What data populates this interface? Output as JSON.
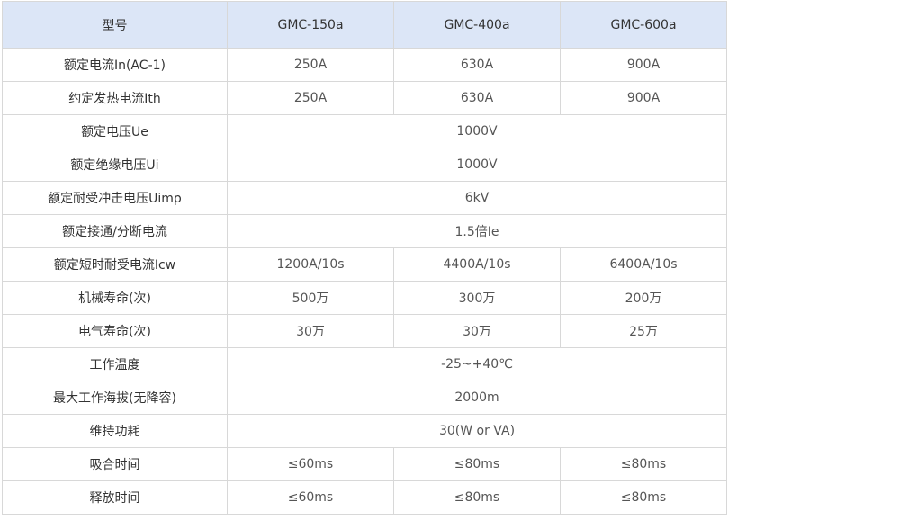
{
  "table": {
    "headers": [
      "型号",
      "GMC-150a",
      "GMC-400a",
      "GMC-600a"
    ],
    "rows": [
      {
        "label": "额定电流In(AC-1)",
        "values": [
          "250A",
          "630A",
          "900A"
        ]
      },
      {
        "label": "约定发热电流Ith",
        "values": [
          "250A",
          "630A",
          "900A"
        ]
      },
      {
        "label": "额定电压Ue",
        "values": [
          "1000V"
        ]
      },
      {
        "label": "额定绝缘电压Ui",
        "values": [
          "1000V"
        ]
      },
      {
        "label": "额定耐受冲击电压Uimp",
        "values": [
          "6kV"
        ]
      },
      {
        "label": "额定接通/分断电流",
        "values": [
          "1.5倍Ie"
        ]
      },
      {
        "label": "额定短时耐受电流Icw",
        "values": [
          "1200A/10s",
          "4400A/10s",
          "6400A/10s"
        ]
      },
      {
        "label": "机械寿命(次)",
        "values": [
          "500万",
          "300万",
          "200万"
        ]
      },
      {
        "label": "电气寿命(次)",
        "values": [
          "30万",
          "30万",
          "25万"
        ]
      },
      {
        "label": "工作温度",
        "values": [
          "-25~+40℃"
        ]
      },
      {
        "label": "最大工作海拔(无降容)",
        "values": [
          "2000m"
        ]
      },
      {
        "label": "维持功耗",
        "values": [
          "30(W or VA)"
        ]
      },
      {
        "label": "吸合时间",
        "values": [
          "≤60ms",
          "≤80ms",
          "≤80ms"
        ]
      },
      {
        "label": "释放时间",
        "values": [
          "≤60ms",
          "≤80ms",
          "≤80ms"
        ]
      }
    ]
  },
  "colors": {
    "header_bg": "#dce6f7",
    "border": "#d8d8d8",
    "text": "#333333"
  }
}
